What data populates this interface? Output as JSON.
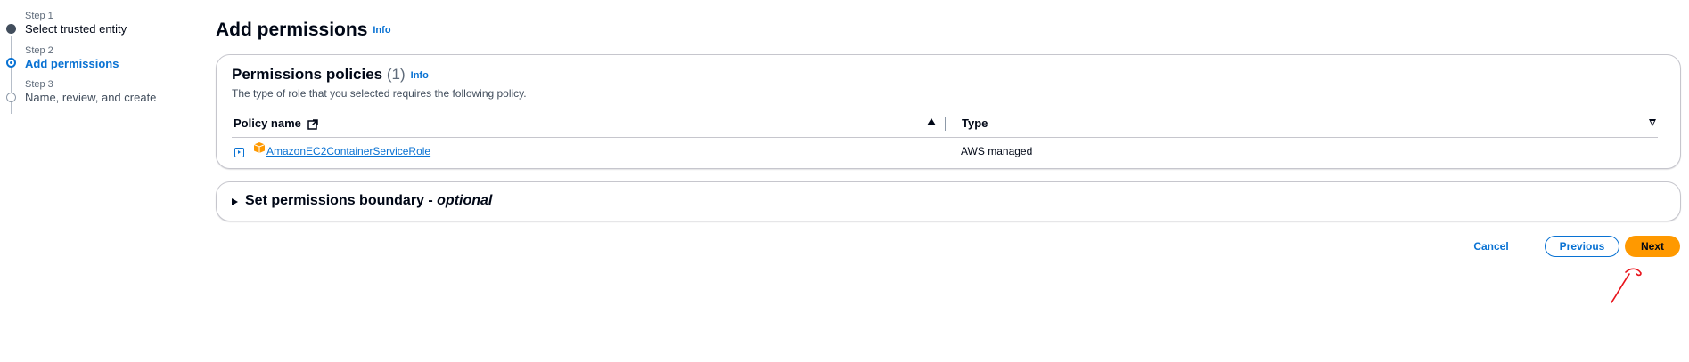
{
  "steps": [
    {
      "number": "Step 1",
      "title": "Select trusted entity",
      "state": "done"
    },
    {
      "number": "Step 2",
      "title": "Add permissions",
      "state": "active"
    },
    {
      "number": "Step 3",
      "title": "Name, review, and create",
      "state": "future"
    }
  ],
  "header": {
    "title": "Add permissions",
    "info_label": "Info"
  },
  "policies_panel": {
    "title": "Permissions policies",
    "count": "(1)",
    "info_label": "Info",
    "description": "The type of role that you selected requires the following policy.",
    "columns": {
      "policy_name": "Policy name",
      "type": "Type"
    },
    "rows": [
      {
        "policy_name": "AmazonEC2ContainerServiceRole",
        "type": "AWS managed",
        "icon": "package-icon"
      }
    ]
  },
  "boundary_panel": {
    "title": "Set permissions boundary",
    "separator": " - ",
    "optional_label": "optional"
  },
  "footer": {
    "cancel_label": "Cancel",
    "previous_label": "Previous",
    "next_label": "Next"
  },
  "colors": {
    "link_blue": "#0972d3",
    "primary_orange": "#ff9900",
    "annotation_red": "#e8141c"
  }
}
